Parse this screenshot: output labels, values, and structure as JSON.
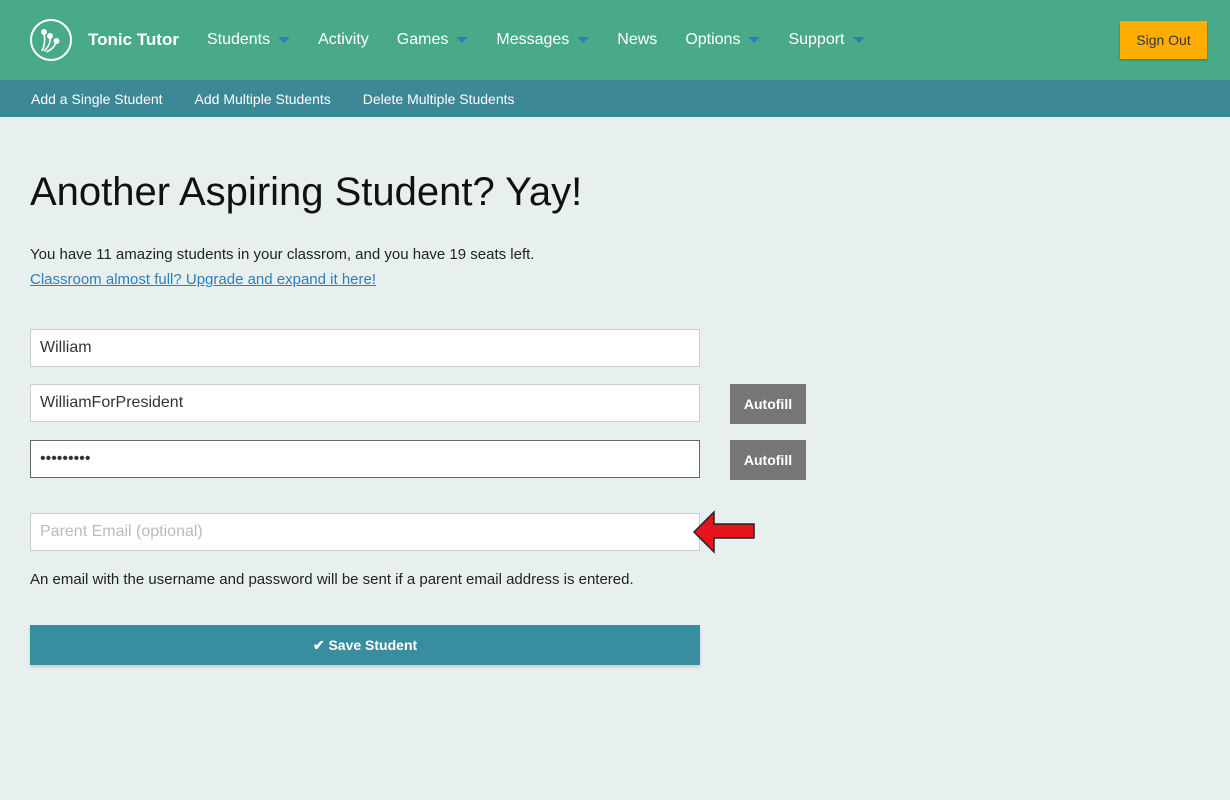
{
  "header": {
    "brand": "Tonic Tutor",
    "nav": [
      {
        "label": "Students",
        "dropdown": true
      },
      {
        "label": "Activity",
        "dropdown": false
      },
      {
        "label": "Games",
        "dropdown": true
      },
      {
        "label": "Messages",
        "dropdown": true
      },
      {
        "label": "News",
        "dropdown": false
      },
      {
        "label": "Options",
        "dropdown": true
      },
      {
        "label": "Support",
        "dropdown": true
      }
    ],
    "sign_out": "Sign Out"
  },
  "subnav": [
    "Add a Single Student",
    "Add Multiple Students",
    "Delete Multiple Students"
  ],
  "main": {
    "title": "Another Aspiring Student? Yay!",
    "info": "You have 11 amazing students in your classrom, and you have 19 seats left.",
    "upgrade_link": "Classroom almost full? Upgrade and expand it here!",
    "name_value": "William",
    "username_value": "WilliamForPresident",
    "password_value": "•••••••••",
    "email_placeholder": "Parent Email (optional)",
    "autofill": "Autofill",
    "note": "An email with the username and password will be sent if a parent email address is entered.",
    "save": "✔ Save Student"
  },
  "colors": {
    "header": "#48aa88",
    "subnav": "#3c8896",
    "signout": "#ffae00",
    "save": "#388d9e",
    "arrow": "#e8141c"
  }
}
